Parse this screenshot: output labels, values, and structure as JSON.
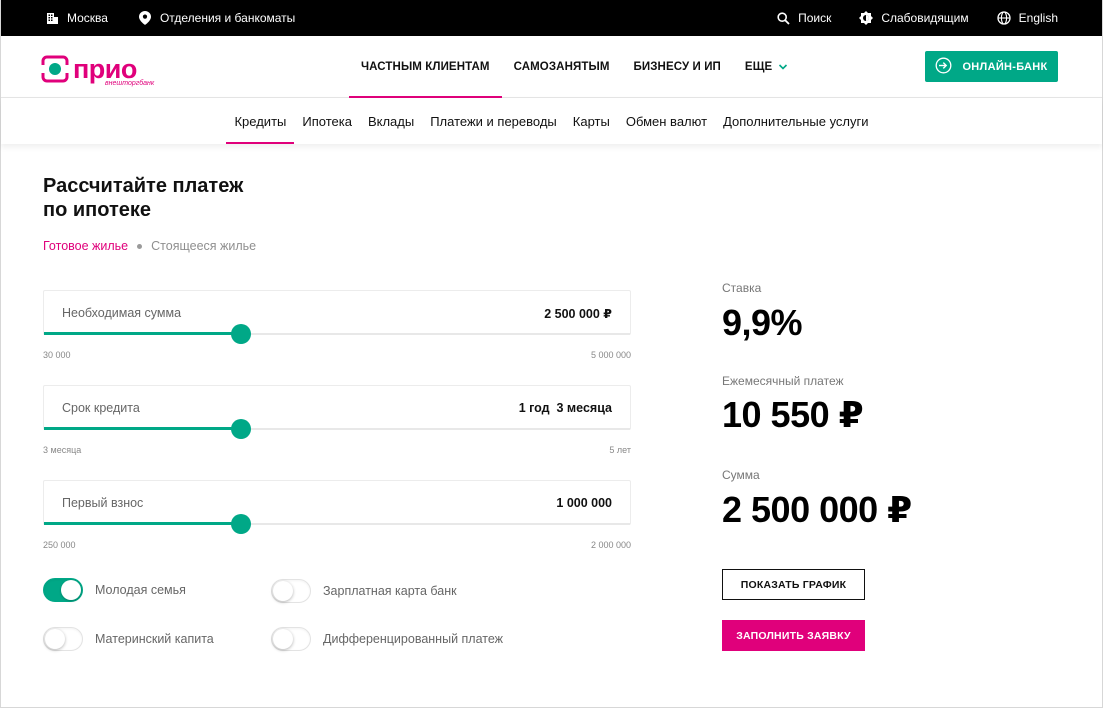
{
  "topbar": {
    "city": "Москва",
    "branches": "Отделения и банкоматы",
    "search": "Поиск",
    "accessibility": "Слабовидящим",
    "language": "English"
  },
  "header": {
    "logo_text": "прио",
    "logo_sub": "внешторгбанк",
    "nav": [
      {
        "label": "ЧАСТНЫМ КЛИЕНТАМ",
        "active": true
      },
      {
        "label": "САМОЗАНЯТЫМ",
        "active": false
      },
      {
        "label": "БИЗНЕСУ И ИП",
        "active": false
      },
      {
        "label": "ЕЩЕ",
        "active": false
      }
    ],
    "online_bank": "ОНЛАЙН-БАНК",
    "brand_color": "#e0007b",
    "accent_color": "#00a887"
  },
  "subnav": {
    "items": [
      {
        "label": "Кредиты",
        "active": true
      },
      {
        "label": "Ипотека",
        "active": false
      },
      {
        "label": "Вклады",
        "active": false
      },
      {
        "label": "Платежи и переводы",
        "active": false
      },
      {
        "label": "Карты",
        "active": false
      },
      {
        "label": "Обмен валют",
        "active": false
      },
      {
        "label": "Дополнительные услуги",
        "active": false
      }
    ]
  },
  "calculator": {
    "title_line1": "Рассчитайте платеж",
    "title_line2": "по ипотеке",
    "property_types": {
      "active": "Готовое жилье",
      "inactive": "Стоящееся жилье"
    },
    "fields": {
      "amount": {
        "label": "Необходимая сумма",
        "value": "2 500 000 ₽",
        "min": "30 000",
        "max": "5 000 000",
        "fill_pct": 33.7
      },
      "term": {
        "label": "Срок кредита",
        "value": "1 год  3 месяца",
        "min": "3 месяца",
        "max": "5 лет",
        "fill_pct": 33.7
      },
      "down_payment": {
        "label": "Первый взнос",
        "value": "1 000 000",
        "min": "250 000",
        "max": "2 000 000",
        "fill_pct": 33.7
      }
    },
    "options": {
      "young_family": {
        "label": "Молодая семья",
        "on": true
      },
      "salary_card": {
        "label": "Зарплатная карта банк",
        "on": false
      },
      "maternity_capital": {
        "label": "Материнский капита",
        "on": false
      },
      "differentiated": {
        "label": "Дифференцированный платеж",
        "on": false
      }
    }
  },
  "summary": {
    "rate_label": "Ставка",
    "rate_value": "9,9%",
    "monthly_label": "Ежемесячный платеж",
    "monthly_value": "10 550 ₽",
    "sum_label": "Сумма",
    "sum_value": "2 500 000 ₽",
    "show_schedule": "ПОКАЗАТЬ ГРАФИК",
    "apply": "ЗАПОЛНИТЬ ЗАЯВКУ"
  }
}
